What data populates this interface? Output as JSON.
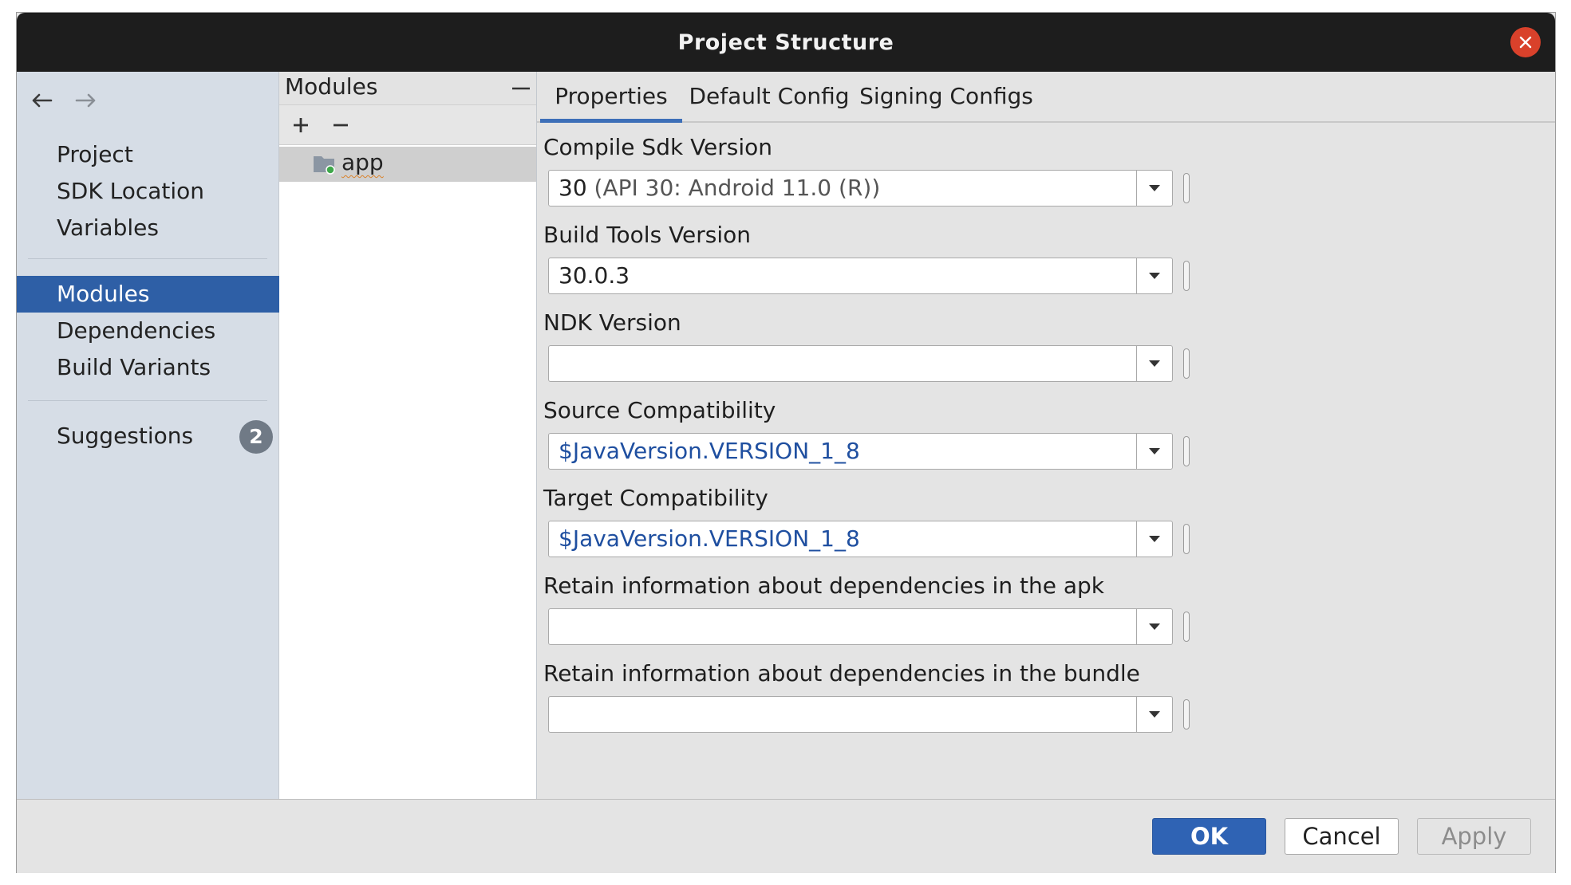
{
  "window": {
    "title": "Project Structure"
  },
  "sidebar": {
    "groups": [
      [
        "Project",
        "SDK Location",
        "Variables"
      ],
      [
        "Modules",
        "Dependencies",
        "Build Variants"
      ],
      [
        "Suggestions"
      ]
    ],
    "selected": "Modules",
    "suggestions_count": "2"
  },
  "modules_panel": {
    "header": "Modules",
    "items": [
      "app"
    ]
  },
  "tabs": [
    "Properties",
    "Default Config",
    "Signing Configs"
  ],
  "active_tab": "Properties",
  "fields": [
    {
      "label": "Compile Sdk Version",
      "value": "30",
      "value_detail": " (API 30: Android 11.0 (R))"
    },
    {
      "label": "Build Tools Version",
      "value": "30.0.3"
    },
    {
      "label": "NDK Version",
      "value": ""
    },
    {
      "label": "Source Compatibility",
      "value": "$JavaVersion.VERSION_1_8"
    },
    {
      "label": "Target Compatibility",
      "value": "$JavaVersion.VERSION_1_8"
    },
    {
      "label": "Retain information about dependencies in the apk",
      "value": ""
    },
    {
      "label": "Retain information about dependencies in the bundle",
      "value": ""
    }
  ],
  "footer": {
    "ok": "OK",
    "cancel": "Cancel",
    "apply": "Apply"
  },
  "colors": {
    "accent": "#2e5fa6",
    "link": "#1f4fa0",
    "close": "#d9412b"
  },
  "icons": [
    "close-icon",
    "back-arrow-icon",
    "forward-arrow-icon",
    "add-icon",
    "remove-icon",
    "folder-icon",
    "chevron-down-icon"
  ]
}
